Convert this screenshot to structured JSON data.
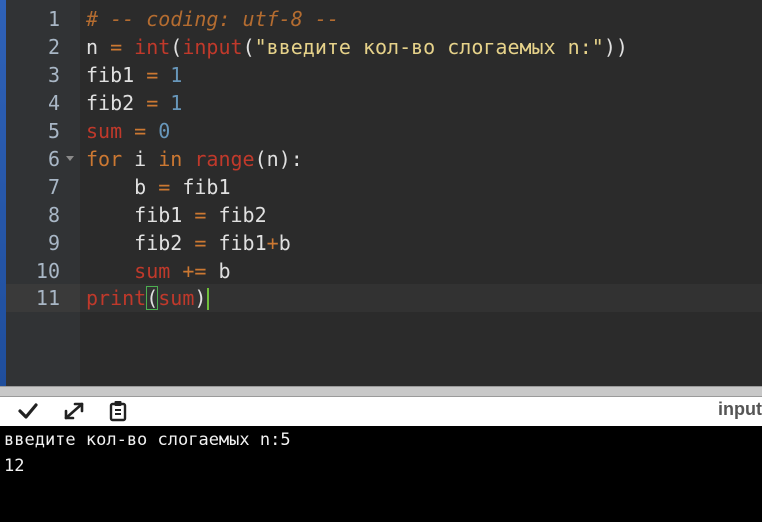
{
  "editor": {
    "lines": [
      {
        "number": "1",
        "text": "# -- coding: utf-8 --"
      },
      {
        "number": "2",
        "n": "n",
        "eq": " = ",
        "int": "int",
        "p1": "(",
        "input": "input",
        "p2": "(",
        "str": "\"введите кол-во слогаемых n:\"",
        "p3": "))"
      },
      {
        "number": "3",
        "var": "fib1",
        "eq": " = ",
        "num": "1"
      },
      {
        "number": "4",
        "var": "fib2",
        "eq": " = ",
        "num": "1"
      },
      {
        "number": "5",
        "var": "sum",
        "eq": " = ",
        "num": "0"
      },
      {
        "number": "6",
        "kw1": "for",
        "sp1": " i ",
        "kw2": "in",
        "sp2": " ",
        "fn": "range",
        "rest": "(n):"
      },
      {
        "number": "7",
        "indent": "    ",
        "lhs": "b",
        "eq": " = ",
        "rhs": "fib1"
      },
      {
        "number": "8",
        "indent": "    ",
        "lhs": "fib1",
        "eq": " = ",
        "rhs": "fib2"
      },
      {
        "number": "9",
        "indent": "    ",
        "lhs": "fib2",
        "eq": " = ",
        "rhs1": "fib1",
        "plus": "+",
        "rhs2": "b"
      },
      {
        "number": "10",
        "indent": "    ",
        "lhs": "sum",
        "eq": " += ",
        "rhs": "b"
      },
      {
        "number": "11",
        "fn": "print",
        "p1": "(",
        "arg": "sum",
        "p2": ")"
      }
    ]
  },
  "toolbar": {
    "run_icon": "checkmark-icon",
    "expand_icon": "expand-arrows-icon",
    "clipboard_icon": "clipboard-icon",
    "label": "input"
  },
  "console": {
    "lines": [
      "введите кол-во слогаемых n:5",
      "12"
    ]
  },
  "colors": {
    "editor_bg": "#2b2b2b",
    "gutter_bg": "#313335",
    "keyword": "#cc7832",
    "builtin": "#c0392b",
    "string": "#e6d28a",
    "number": "#6897bb",
    "console_bg": "#000000"
  }
}
